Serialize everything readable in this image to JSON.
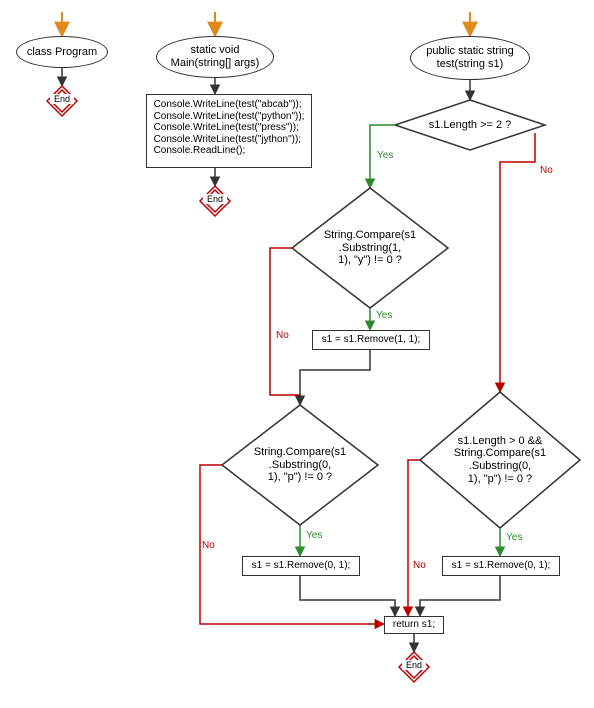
{
  "col1": {
    "entry": "class Program",
    "end": "End"
  },
  "col2": {
    "entry": "static void\nMain(string[] args)",
    "body": "Console.WriteLine(test(\"abcab\"));\nConsole.WriteLine(test(\"python\"));\nConsole.WriteLine(test(\"press\"));\nConsole.WriteLine(test(\"jython\"));\nConsole.ReadLine();",
    "end": "End"
  },
  "col3": {
    "entry": "public static string\ntest(string s1)",
    "decision1": "s1.Length >= 2 ?",
    "decision2": "String.Compare(s1\n.Substring(1,\n1), \"y\") != 0 ?",
    "action2": "s1 = s1.Remove(1, 1);",
    "decision3": "String.Compare(s1\n.Substring(0,\n1), \"p\") != 0 ?",
    "action3": "s1 = s1.Remove(0, 1);",
    "decision4": "s1.Length > 0 &&\nString.Compare(s1\n.Substring(0,\n1), \"p\") != 0 ?",
    "action4": "s1 = s1.Remove(0, 1);",
    "ret": "return s1;",
    "end": "End"
  },
  "labels": {
    "yes": "Yes",
    "no": "No"
  }
}
